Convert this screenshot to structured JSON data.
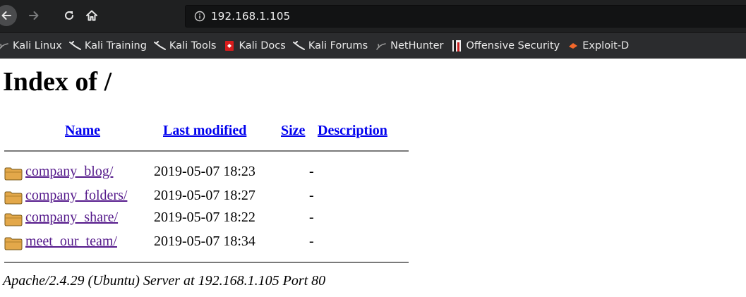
{
  "browser": {
    "url": "192.168.1.105",
    "bookmarks": [
      {
        "label": "Kali Linux",
        "icon": "kali-dragon-icon"
      },
      {
        "label": "Kali Training",
        "icon": "kali-dragon-icon"
      },
      {
        "label": "Kali Tools",
        "icon": "kali-dragon-icon"
      },
      {
        "label": "Kali Docs",
        "icon": "kali-docs-icon"
      },
      {
        "label": "Kali Forums",
        "icon": "kali-dragon-icon"
      },
      {
        "label": "NetHunter",
        "icon": "nethunter-icon"
      },
      {
        "label": "Offensive Security",
        "icon": "offsec-icon"
      },
      {
        "label": "Exploit-D",
        "icon": "exploit-db-icon"
      }
    ]
  },
  "page": {
    "title": "Index of /",
    "columns": {
      "name": "Name",
      "last_modified": "Last modified",
      "size": "Size",
      "description": "Description"
    },
    "rows": [
      {
        "name": "company_blog/",
        "modified": "2019-05-07 18:23",
        "size": "-"
      },
      {
        "name": "company_folders/",
        "modified": "2019-05-07 18:27",
        "size": "-"
      },
      {
        "name": "company_share/",
        "modified": "2019-05-07 18:22",
        "size": "-"
      },
      {
        "name": "meet_our_team/",
        "modified": "2019-05-07 18:34",
        "size": "-"
      }
    ],
    "footer": "Apache/2.4.29 (Ubuntu) Server at 192.168.1.105 Port 80"
  },
  "colors": {
    "link": "#0000ee",
    "visited": "#551a8b",
    "toolbar": "#1f2021",
    "bookmarks_bar": "#2b2c2e"
  }
}
